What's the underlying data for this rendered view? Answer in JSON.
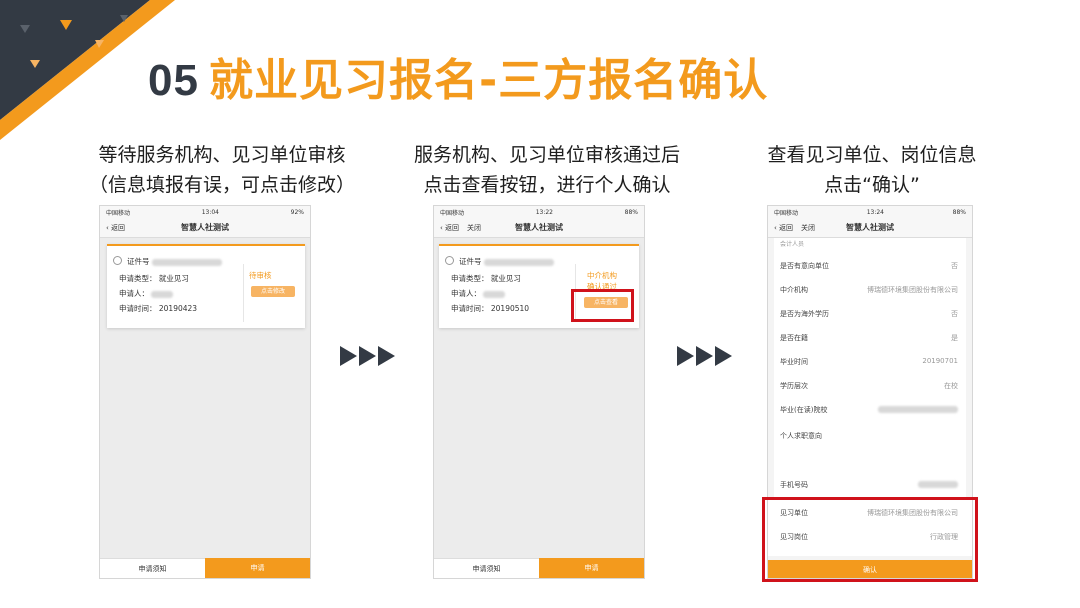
{
  "slide": {
    "title_num": "05",
    "title_text": "就业见习报名-三方报名确认"
  },
  "captions": {
    "c1_line1": "等待服务机构、见习单位审核",
    "c1_line2": "（信息填报有误，可点击修改）",
    "c2_line1": "服务机构、见习单位审核通过后",
    "c2_line2": "点击查看按钮，进行个人确认",
    "c3_line1": "查看见习单位、岗位信息",
    "c3_line2": "点击“确认”"
  },
  "colors": {
    "accent": "#f39a1d",
    "dark": "#333a44",
    "highlight": "#d0121b"
  },
  "phone1": {
    "carrier": "中国移动",
    "time": "13:04",
    "battery": "92%",
    "back": "返回",
    "nav_title": "智慧人社测试",
    "id_label": "证件号",
    "type_label": "申请类型：",
    "type_value": "就业见习",
    "applicant_label": "申请人：",
    "date_label": "申请时间：",
    "date_value": "20190423",
    "status": "待审核",
    "action": "点击修改",
    "tab_notice": "申请须知",
    "tab_apply": "申请"
  },
  "phone2": {
    "carrier": "中国移动",
    "time": "13:22",
    "battery": "88%",
    "back": "返回",
    "close": "关闭",
    "nav_title": "智慧人社测试",
    "id_label": "证件号",
    "type_label": "申请类型：",
    "type_value": "就业见习",
    "applicant_label": "申请人：",
    "date_label": "申请时间：",
    "date_value": "20190510",
    "status_line1": "中介机构",
    "status_line2": "确认通过",
    "action": "点击查看",
    "tab_notice": "申请须知",
    "tab_apply": "申请"
  },
  "phone3": {
    "carrier": "中国移动",
    "time": "13:24",
    "battery": "88%",
    "back": "返回",
    "close": "关闭",
    "nav_title": "智慧人社测试",
    "top_clip": "会计人员",
    "items": [
      {
        "label": "是否有意向单位",
        "value": "否"
      },
      {
        "label": "中介机构",
        "value": "博瑞德环境集团股份有限公司"
      },
      {
        "label": "是否为海外学历",
        "value": "否"
      },
      {
        "label": "是否在籍",
        "value": "是"
      },
      {
        "label": "毕业时间",
        "value": "20190701"
      },
      {
        "label": "学历层次",
        "value": "在校"
      },
      {
        "label": "毕业(在读)院校",
        "value": ""
      },
      {
        "label": "个人求职意向",
        "value": ""
      },
      {
        "label": "手机号码",
        "value": ""
      },
      {
        "label": "见习单位",
        "value": "博瑞德环境集团股份有限公司"
      },
      {
        "label": "见习岗位",
        "value": "行政管理"
      }
    ],
    "confirm": "确认"
  }
}
